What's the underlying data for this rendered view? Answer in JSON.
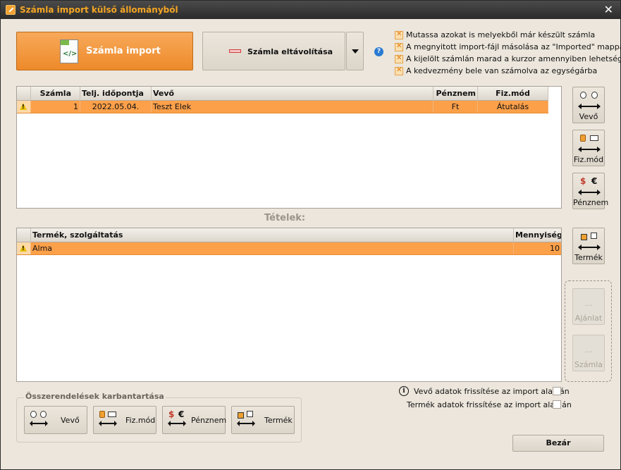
{
  "window": {
    "title": "Számla import külső állományból",
    "close_glyph": "✕"
  },
  "toolbar": {
    "import_label": "Számla import",
    "import_icon": "xml-document-icon",
    "remove_label": "Számla eltávolítása",
    "remove_icon": "minus-icon"
  },
  "options": [
    {
      "label": "Mutassa azokat is melyekből már készült számla",
      "checked": true
    },
    {
      "label": "A megnyitott import-fájl másolása az \"Imported\" mappába",
      "checked": true
    },
    {
      "label": "A kijelölt számlán marad a kurzor amennyiben lehetséges",
      "checked": true
    },
    {
      "label": "A kedvezmény bele van számolva az egységárba",
      "checked": true
    }
  ],
  "invoices": {
    "columns": [
      "Számla",
      "Telj. időpontja",
      "Vevő",
      "Pénznem",
      "Fiz.mód"
    ],
    "rows": [
      {
        "szamla": "1",
        "datum": "2022.05.04.",
        "vevo": "Teszt Elek",
        "penznem": "Ft",
        "fizmod": "Átutalás"
      }
    ]
  },
  "items_title": "Tételek:",
  "items": {
    "columns": [
      "Termék, szolgáltatás",
      "Mennyiség"
    ],
    "rows": [
      {
        "termek": "Alma",
        "mennyiseg": "10"
      }
    ]
  },
  "side_buttons": {
    "vevo": "Vevő",
    "fizmod": "Fiz.mód",
    "penznem": "Pénznem",
    "termek": "Termék",
    "ajanlat": "Ajánlat",
    "szamla": "Számla",
    "dots": "..."
  },
  "currency_symbols": {
    "dollar": "$",
    "euro": "€"
  },
  "mapping_group": {
    "title": "Összerendelések karbantartása",
    "vevo": "Vevő",
    "fizmod": "Fiz.mód",
    "penznem": "Pénznem",
    "termek": "Termék"
  },
  "refresh": {
    "info_glyph": "i",
    "vevo_label": "Vevő adatok frissítése az import alapján",
    "termek_label": "Termék adatok frissítése az import alapján"
  },
  "close_button": "Bezár",
  "colors": {
    "accent": "#ee8a2a",
    "selected_row": "#fca04a",
    "title_text": "#f5a623"
  }
}
